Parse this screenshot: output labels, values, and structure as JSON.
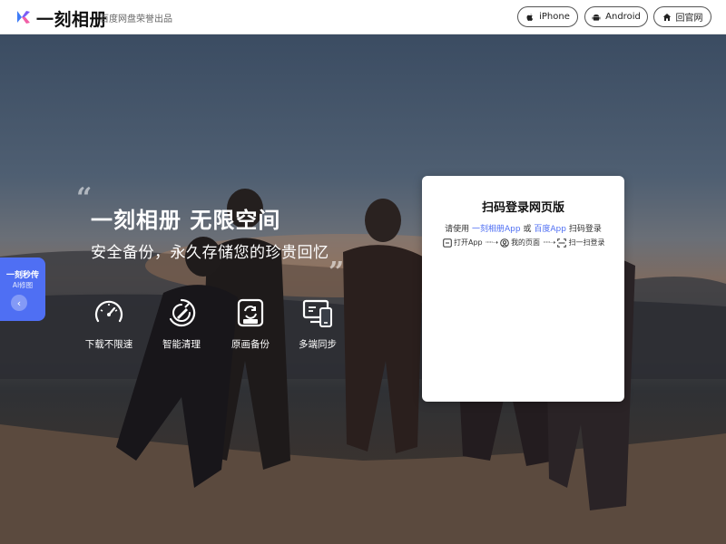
{
  "header": {
    "brand": "一刻相册",
    "tagline": "百度网盘荣誉出品",
    "buttons": [
      {
        "label": "iPhone",
        "icon": "apple-icon"
      },
      {
        "label": "Android",
        "icon": "android-icon"
      },
      {
        "label": "回官网",
        "icon": "home-icon"
      }
    ]
  },
  "hero": {
    "title": "一刻相册 无限空间",
    "subtitle": "安全备份，永久存储您的珍贵回忆",
    "features": [
      {
        "label": "下载不限速",
        "icon": "speedometer-icon"
      },
      {
        "label": "智能清理",
        "icon": "broom-icon"
      },
      {
        "label": "原画备份",
        "icon": "original-backup-icon"
      },
      {
        "label": "多端同步",
        "icon": "multi-device-icon"
      }
    ]
  },
  "side_tab": {
    "title": "一刻秒传",
    "subtitle": "AI修图",
    "arrow": "‹"
  },
  "login": {
    "title": "扫码登录网页版",
    "instruction_prefix": "请使用",
    "app1": "一刻相册App",
    "or": "或",
    "app2": "百度App",
    "instruction_suffix": "扫码登录",
    "steps": [
      {
        "label": "打开App",
        "icon": "app-box-icon"
      },
      {
        "label": "我的页面",
        "icon": "profile-icon"
      },
      {
        "label": "扫一扫登录",
        "icon": "scan-icon"
      }
    ],
    "step_arrow": "·····➝"
  },
  "colors": {
    "accent": "#4f6ff3",
    "header_bg": "#ffffff",
    "text_dark": "#111111"
  }
}
